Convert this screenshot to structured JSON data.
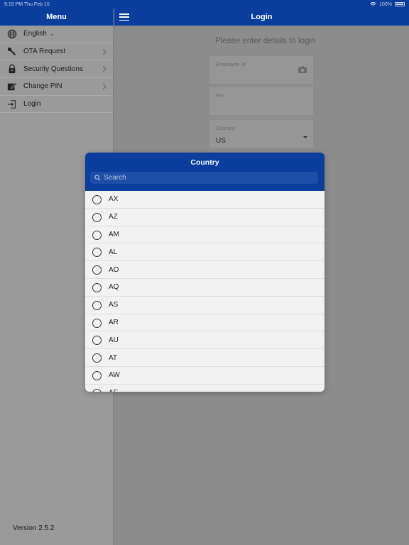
{
  "status_bar": {
    "time": "9:19 PM",
    "date": "Thu Feb 10",
    "battery": "100%"
  },
  "sidebar": {
    "title": "Menu",
    "items": [
      {
        "label": "English",
        "icon": "globe-icon",
        "has_caret": true
      },
      {
        "label": "OTA Request",
        "icon": "key-icon",
        "has_chevron": true
      },
      {
        "label": "Security Questions",
        "icon": "lock-icon",
        "has_chevron": true
      },
      {
        "label": "Change PIN",
        "icon": "edit-icon",
        "has_chevron": true
      },
      {
        "label": "Login",
        "icon": "login-icon"
      }
    ],
    "version": "Version 2.5.2"
  },
  "main": {
    "title": "Login",
    "prompt": "Please enter details to login",
    "employee_id_label": "Employee Id",
    "pin_label": "Pin",
    "country_label": "Country",
    "country_value": "US"
  },
  "modal": {
    "title": "Country",
    "search_placeholder": "Search",
    "countries": [
      "AX",
      "AZ",
      "AM",
      "AL",
      "AO",
      "AQ",
      "AS",
      "AR",
      "AU",
      "AT",
      "AW",
      "AE"
    ]
  },
  "colors": {
    "brand": "#0a3d9c",
    "overlay": "#8c8c8c"
  }
}
